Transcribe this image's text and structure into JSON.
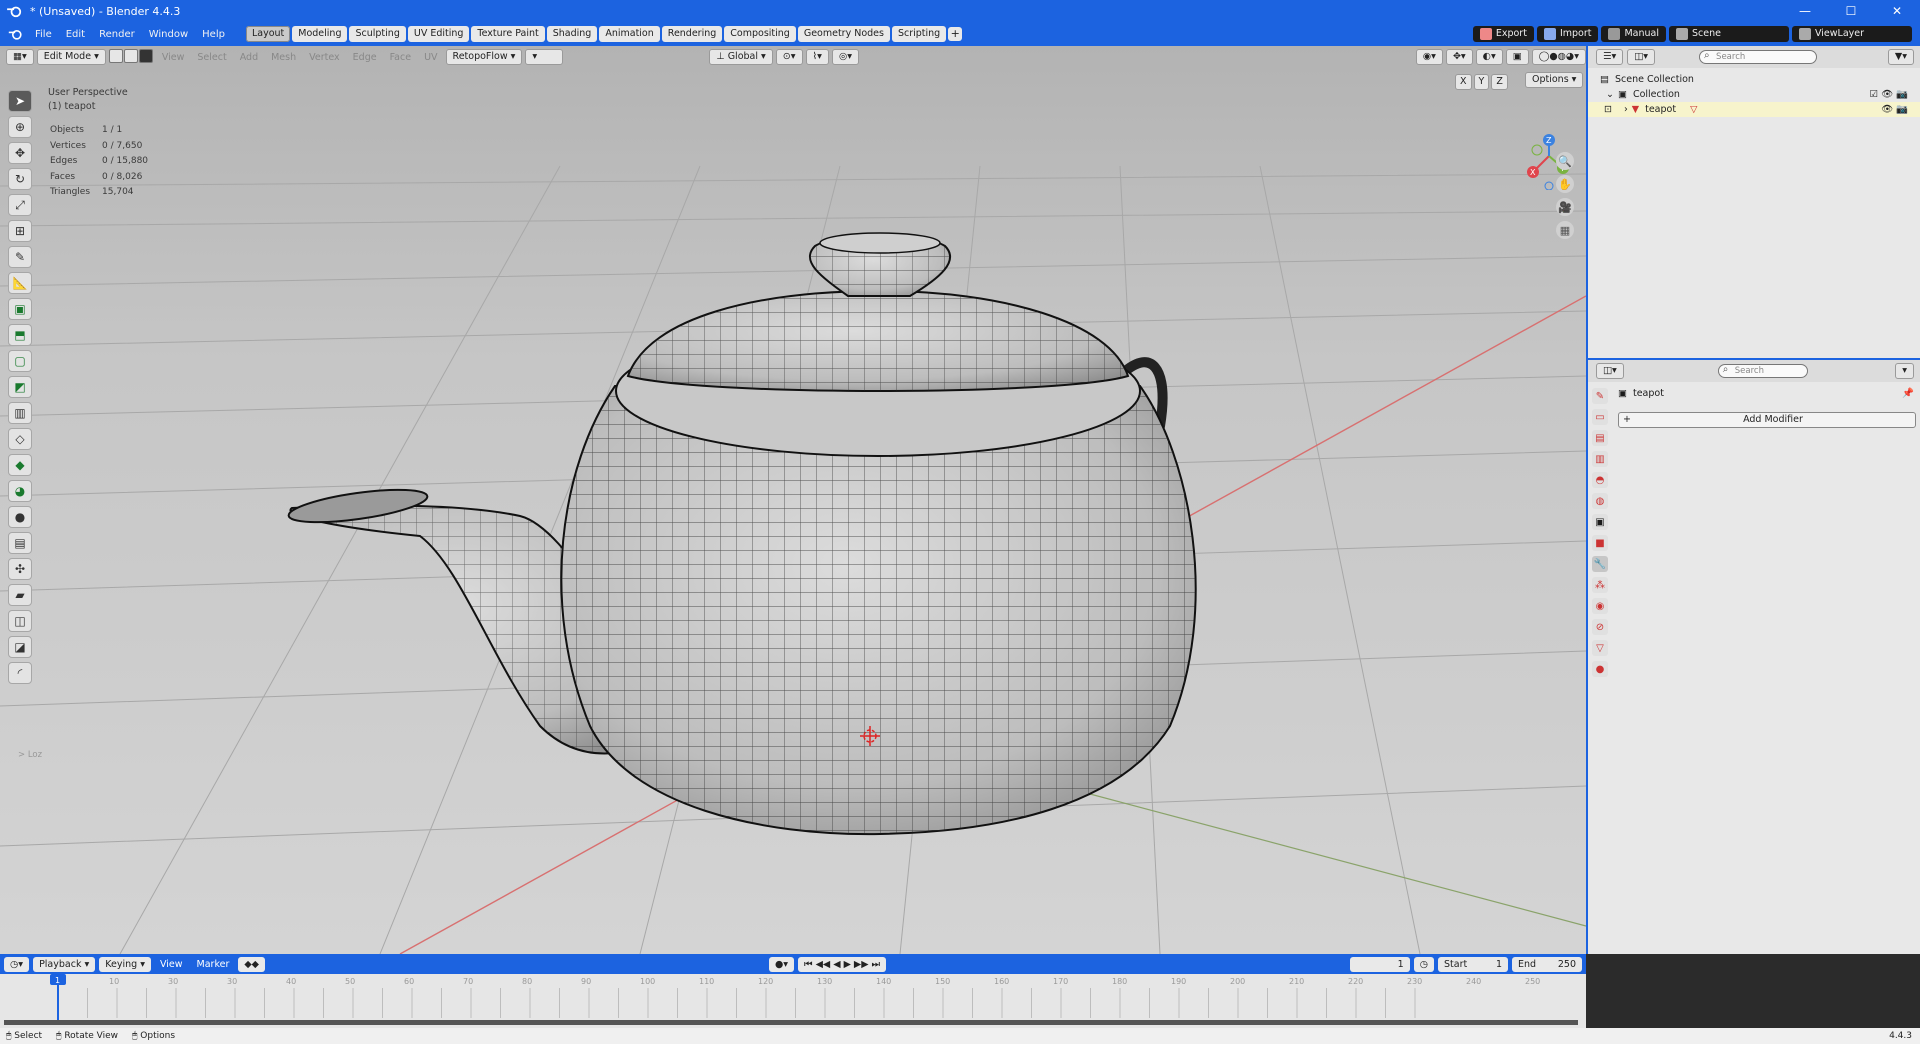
{
  "window": {
    "title": "* (Unsaved) - Blender 4.4.3",
    "controls": [
      "—",
      "☐",
      "✕"
    ]
  },
  "menu": [
    "File",
    "Edit",
    "Render",
    "Window",
    "Help"
  ],
  "workspaces": {
    "tabs": [
      "Layout",
      "Modeling",
      "Sculpting",
      "UV Editing",
      "Texture Paint",
      "Shading",
      "Animation",
      "Rendering",
      "Compositing",
      "Geometry Nodes",
      "Scripting"
    ],
    "active": "Layout",
    "add_label": "+"
  },
  "top_right": {
    "export_label": "Export",
    "import_label": "Import",
    "manual_label": "Manual",
    "scene_label": "Scene",
    "viewlayer_label": "ViewLayer"
  },
  "viewport_header": {
    "mode_label": "Edit Mode",
    "menus": [
      "View",
      "Select",
      "Add",
      "Mesh",
      "Vertex",
      "Edge",
      "Face",
      "UV"
    ],
    "addon_label": "RetopoFlow",
    "orientation_label": "Global",
    "options_label": "Options",
    "axis_labels": [
      "X",
      "Y",
      "Z"
    ]
  },
  "viewport_info": {
    "perspective": "User Perspective",
    "object": "(1) teapot",
    "stats": [
      {
        "label": "Objects",
        "value": "1 / 1"
      },
      {
        "label": "Vertices",
        "value": "0 / 7,650"
      },
      {
        "label": "Edges",
        "value": "0 / 15,880"
      },
      {
        "label": "Faces",
        "value": "0 / 8,026"
      },
      {
        "label": "Triangles",
        "value": "15,704"
      }
    ],
    "last_op": "> Loz"
  },
  "gizmo": {
    "x": "X",
    "y": "Y",
    "z": "Z"
  },
  "outliner": {
    "search_placeholder": "Search",
    "scene_collection": "Scene Collection",
    "collection": "Collection",
    "object": "teapot"
  },
  "properties": {
    "search_placeholder": "Search",
    "object_name": "teapot",
    "add_modifier_label": "Add Modifier"
  },
  "timeline": {
    "menus": [
      "Playback",
      "Keying",
      "View",
      "Marker"
    ],
    "current_frame": "1",
    "start_label": "Start",
    "start_value": "1",
    "end_label": "End",
    "end_value": "250",
    "ticks": [
      "1",
      "10",
      "30",
      "30",
      "40",
      "50",
      "60",
      "70",
      "80",
      "90",
      "100",
      "110",
      "120",
      "130",
      "140",
      "150",
      "160",
      "170",
      "180",
      "190",
      "200",
      "210",
      "220",
      "230",
      "240",
      "250"
    ]
  },
  "statusbar": {
    "select_label": "Select",
    "rotate_label": "Rotate View",
    "options_label": "Options",
    "version": "4.4.3"
  },
  "colors": {
    "accent": "#1c63e0",
    "axis_x": "#e0454d",
    "axis_y": "#7ab341",
    "axis_z": "#3b82e0"
  }
}
